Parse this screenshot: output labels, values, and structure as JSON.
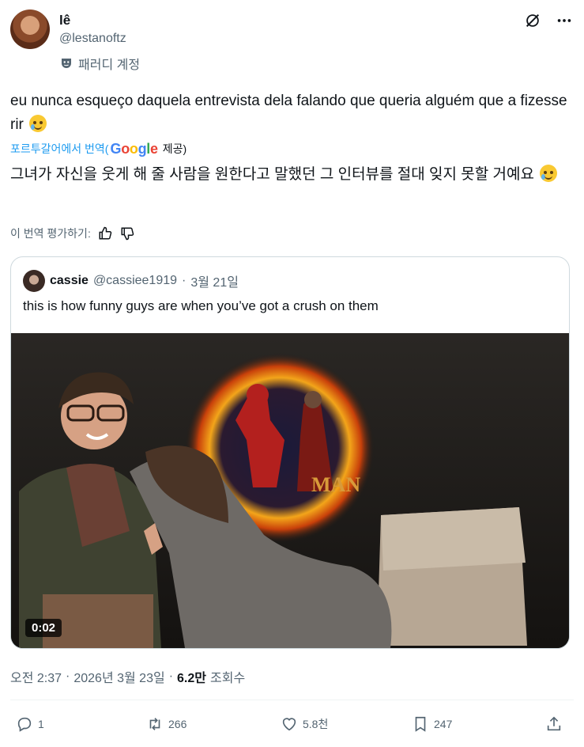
{
  "author": {
    "display_name": "lê",
    "handle": "@lestanoftz",
    "parody_label": "패러디 계정"
  },
  "tweet": {
    "text": "eu nunca esqueço daquela entrevista dela falando que queria alguém que a fizesse rir",
    "translate_prefix": "포르투갈어에서 번역(",
    "translate_provider": "Google",
    "translate_suffix": "제공)",
    "translated_text": "그녀가 자신을 웃게 해 줄 사람을 원한다고 말했던 그 인터뷰를 절대 잊지 못할 거예요",
    "rate_label": "이 번역 평가하기:"
  },
  "quote": {
    "name": "cassie",
    "handle": "@cassiee1919",
    "separator": "·",
    "date": "3월 21일",
    "text": "this is how funny guys are when you’ve got a crush on them",
    "video_time": "0:02"
  },
  "meta": {
    "time": "오전 2:37",
    "sep1": "·",
    "date": "2026년 3월 23일",
    "sep2": "·",
    "views": "6.2만",
    "views_label": "조회수"
  },
  "actions": {
    "replies": "1",
    "reposts": "266",
    "likes": "5.8천",
    "bookmarks": "247"
  },
  "icons": {
    "header": [
      "grok-icon",
      "more-icon"
    ],
    "parody": "parody-mask-icon",
    "rate": [
      "thumbs-up-icon",
      "thumbs-down-icon"
    ],
    "actions": [
      "reply-icon",
      "repost-icon",
      "like-icon",
      "bookmark-icon",
      "share-icon"
    ]
  },
  "colors": {
    "accent": "#1d9bf0",
    "secondary_text": "#536471",
    "primary_text": "#0f1419",
    "border": "#cfd9de"
  }
}
